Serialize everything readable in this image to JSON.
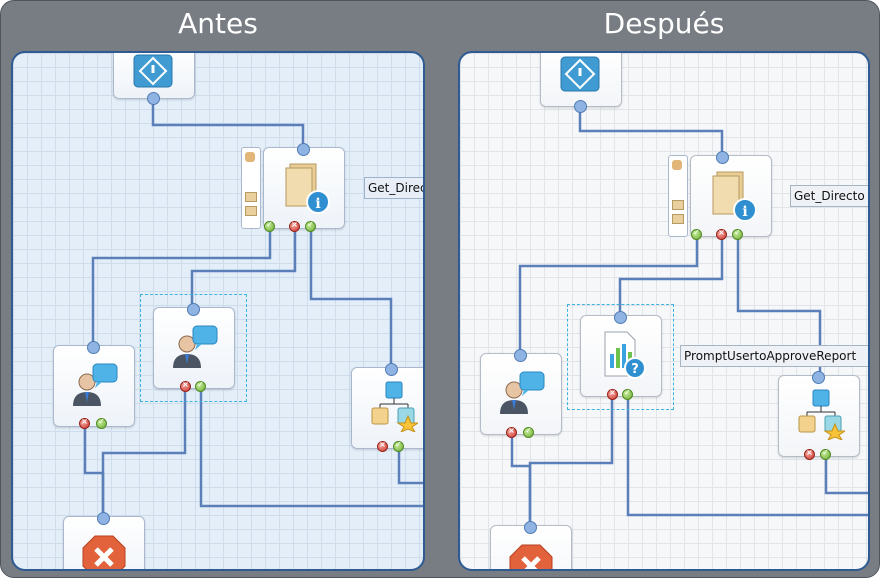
{
  "titles": {
    "before": "Antes",
    "after": "Después"
  },
  "before": {
    "labels": {
      "get_directory": "Get_Direct"
    }
  },
  "after": {
    "labels": {
      "get_directory": "Get_Directo",
      "prompt_user": "PromptUsertoApproveReport"
    }
  },
  "colors": {
    "frame": "#787d84",
    "panel_border": "#2f5a92",
    "wire": "#5b7fb8",
    "selection": "#3db4e0"
  }
}
